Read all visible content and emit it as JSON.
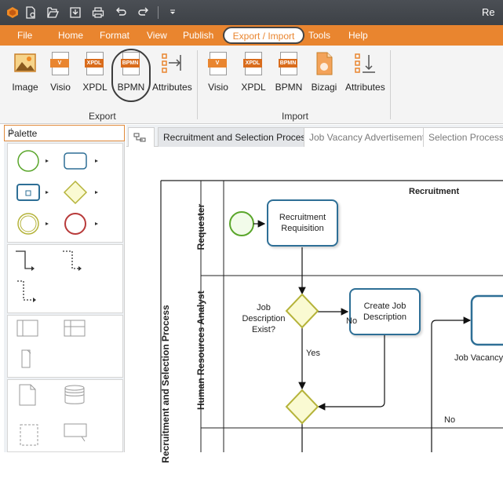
{
  "window": {
    "title_partial": "Re"
  },
  "quick_access": {
    "icons": [
      "app-logo-icon",
      "new-file-icon",
      "open-file-icon",
      "save-icon",
      "print-icon",
      "undo-icon",
      "redo-icon",
      "customize-icon"
    ]
  },
  "menu": {
    "items": [
      "File",
      "Home",
      "Format",
      "View",
      "Publish",
      "Export / Import",
      "Tools",
      "Help"
    ],
    "selected": "Export / Import"
  },
  "ribbon": {
    "export": {
      "label": "Export",
      "buttons": [
        "Image",
        "Visio",
        "XPDL",
        "BPMN",
        "Attributes"
      ]
    },
    "import": {
      "label": "Import",
      "buttons": [
        "Visio",
        "XPDL",
        "BPMN",
        "Bizagi",
        "Attributes"
      ]
    },
    "doc_tags": {
      "visio": "V",
      "xpdl": "XPDL",
      "bpmn": "BPMN"
    }
  },
  "palette": {
    "title": "Palette"
  },
  "tabs": {
    "items": [
      "Recruitment and Selection Process",
      "Job Vacancy Advertisement",
      "Selection Process"
    ],
    "active": "Recruitment and Selection Process"
  },
  "diagram": {
    "pool_title": "Recruitment and Selection Process",
    "phase_title": "Recruitment",
    "lanes": [
      "Requester",
      "Human Resources Analyst"
    ],
    "tasks": {
      "t1": "Recruitment Requisition",
      "t2": "Create Job Description",
      "t3": "Job Vacancy"
    },
    "gateway_question": "Job Description Exist?",
    "labels": {
      "no1": "No",
      "yes": "Yes",
      "no2": "No"
    }
  },
  "colors": {
    "accent": "#e9852f",
    "titlebar": "#43474c",
    "task_border": "#2e6f96",
    "start_event": "#5aa62b",
    "end_event": "#b83a3a",
    "gateway_fill": "#fafad2",
    "gateway_stroke": "#b5b33a"
  }
}
